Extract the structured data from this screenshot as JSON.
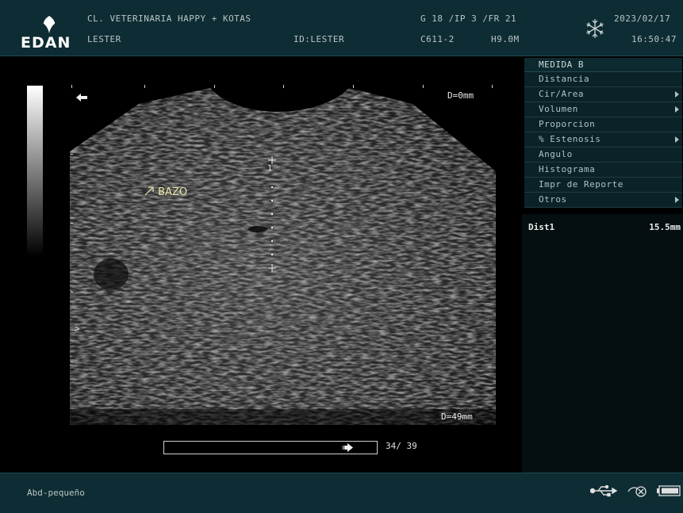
{
  "header": {
    "logo_text": "EDAN",
    "clinic": "CL. VETERINARIA HAPPY + KOTAS",
    "patient": "LESTER",
    "patient_id": "ID:LESTER",
    "params": "G 18 /IP 3 /FR 21",
    "probe": "C611-2",
    "frequency": "H9.0M",
    "date": "2023/02/17",
    "time": "16:50:47",
    "freeze_icon": "snowflake-icon"
  },
  "image": {
    "depth_top": "D=0mm",
    "depth_bottom": "D=49mm",
    "annotation": "BAZO",
    "caliper_label": "1",
    "focus_marker": ">",
    "orientation_icon": "left-arrow-icon"
  },
  "cine": {
    "counter": "34/ 39"
  },
  "menu": {
    "title": "MEDIDA B",
    "items": [
      {
        "label": "Distancia",
        "submenu": false
      },
      {
        "label": "Cir/Area",
        "submenu": true
      },
      {
        "label": "Volumen",
        "submenu": true
      },
      {
        "label": "Proporcion",
        "submenu": false
      },
      {
        "label": "% Estenosis",
        "submenu": true
      },
      {
        "label": "Angulo",
        "submenu": false
      },
      {
        "label": "Histograma",
        "submenu": false
      },
      {
        "label": "Impr de Reporte",
        "submenu": false
      },
      {
        "label": "Otros",
        "submenu": true
      }
    ]
  },
  "results": {
    "label": "Dist1",
    "value": "15.5mm"
  },
  "footer": {
    "preset": "Abd-pequeño",
    "icons": [
      "usb-icon",
      "network-icon",
      "battery-icon"
    ]
  },
  "colors": {
    "panel_bg": "#0e2c33",
    "annotation": "#e8e6a8"
  }
}
